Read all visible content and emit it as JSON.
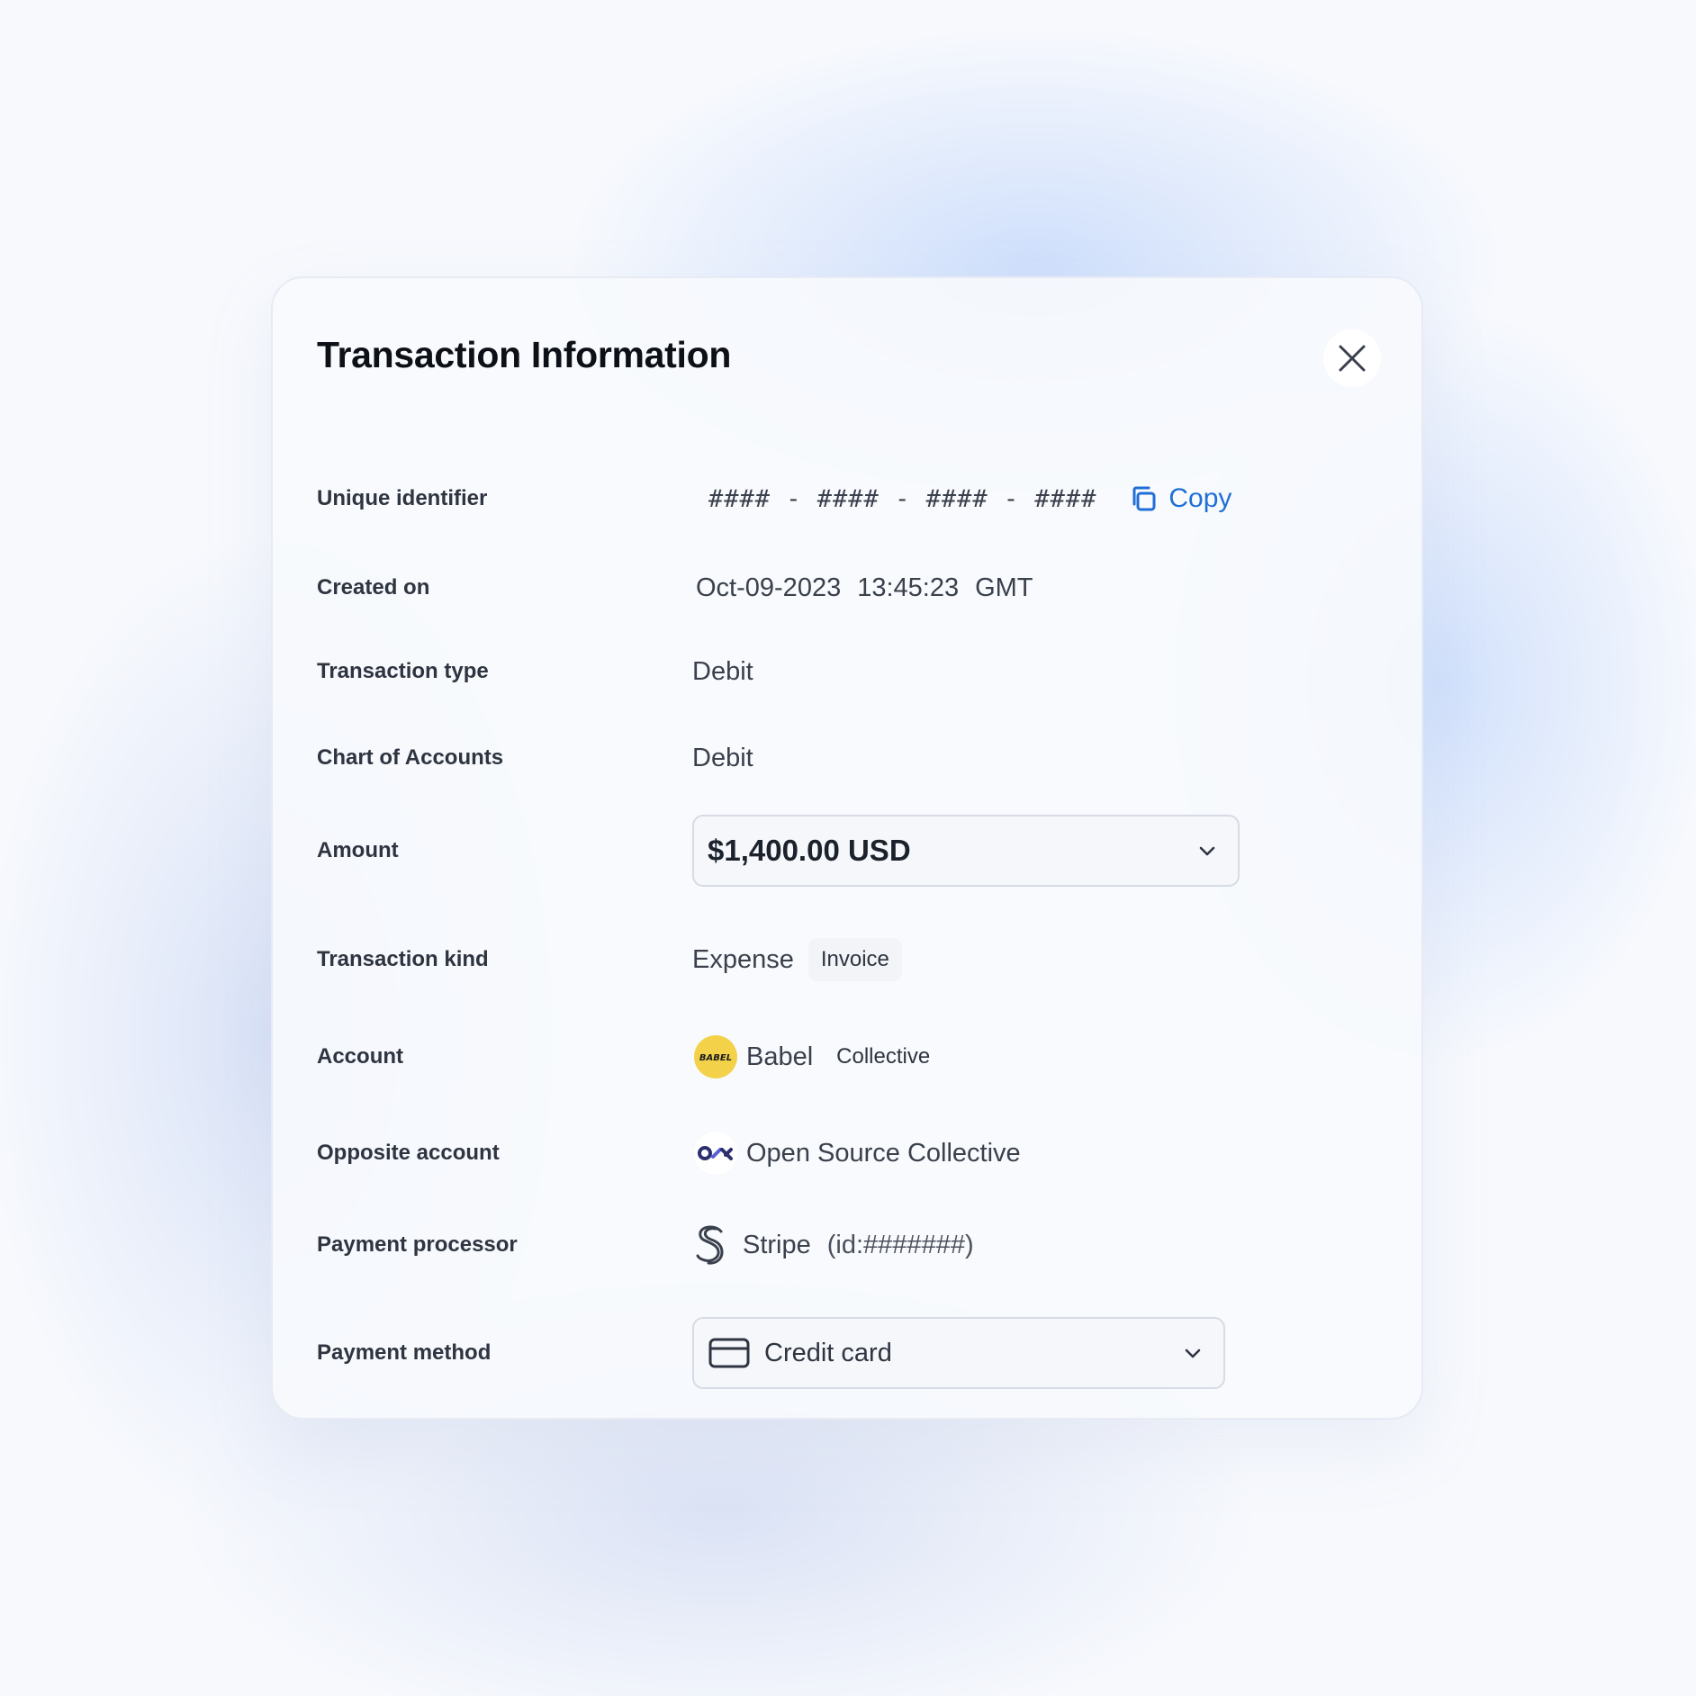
{
  "modal": {
    "title": "Transaction Information"
  },
  "fields": {
    "unique_identifier": {
      "label": "Unique identifier",
      "value": "#### - #### - #### - ####",
      "copy_label": "Copy"
    },
    "created_on": {
      "label": "Created on",
      "date": "Oct-09-2023",
      "time": "13:45:23",
      "timezone": "GMT"
    },
    "transaction_type": {
      "label": "Transaction type",
      "value": "Debit"
    },
    "chart_of_accounts": {
      "label": "Chart of Accounts",
      "value": "Debit"
    },
    "amount": {
      "label": "Amount",
      "value": "$1,400.00 USD"
    },
    "transaction_kind": {
      "label": "Transaction kind",
      "value": "Expense",
      "tag": "Invoice"
    },
    "account": {
      "label": "Account",
      "name": "Babel",
      "tag": "Collective",
      "avatar_text": "BABEL",
      "avatar_color": "#f3d24a"
    },
    "opposite_account": {
      "label": "Opposite account",
      "name": "Open Source Collective"
    },
    "payment_processor": {
      "label": "Payment processor",
      "name": "Stripe",
      "id": "(id:#######)"
    },
    "payment_method": {
      "label": "Payment method",
      "value": "Credit card"
    }
  },
  "colors": {
    "accent": "#1f6fd6",
    "title": "#0d1117",
    "label": "#2e3440",
    "osc_brand": "#2b2f6e"
  },
  "icons": {
    "close": "close-icon",
    "copy": "copy-icon",
    "chevron": "chevron-down-icon",
    "card": "credit-card-icon",
    "stripe": "stripe-logo-icon"
  }
}
